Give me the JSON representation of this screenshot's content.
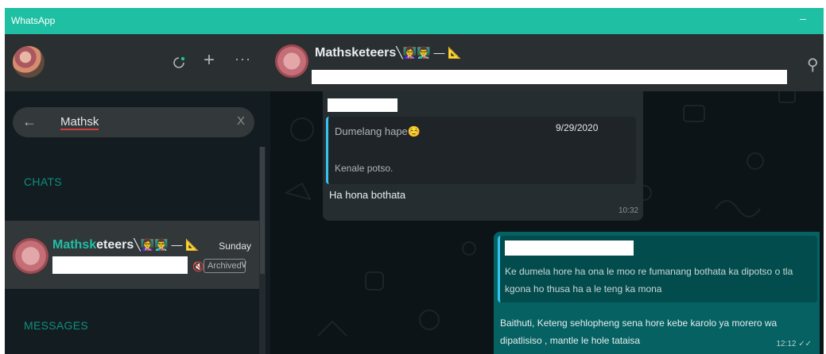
{
  "window": {
    "title": "WhatsApp",
    "minimize_symbol": "‒"
  },
  "sidebar": {
    "avatar_icon": "profile-avatar",
    "status_icon": "status-icon",
    "new_chat_symbol": "+",
    "menu_symbol": "···",
    "search": {
      "back_symbol": "←",
      "query": "Mathsk",
      "clear_symbol": "X"
    },
    "sections": {
      "chats": "CHATS",
      "messages": "MESSAGES"
    },
    "chat": {
      "name_match": "Mathsk",
      "name_rest": "eteers",
      "name_emojis": "╲👩‍🏫👨‍🏫 — 📐",
      "day": "Sunday",
      "archived": "Archived",
      "mute_symbol": "🔇",
      "chevron": "∨"
    }
  },
  "conversation": {
    "title": "Mathsketeers",
    "title_emojis": "╲👩‍🏫👨‍🏫 — 📐",
    "search_symbol": "⚲",
    "incoming": {
      "quote_line1": "Dumelang hape☺️",
      "quote_line2": "Kenale potso.",
      "quote_date": "9/29/2020",
      "text": "Ha hona bothata",
      "time": "10:32"
    },
    "outgoing": {
      "quote": "Ke dumela hore ha ona le moo re fumanang bothata ka dipotso o tla kgona ho thusa ha a le teng ka mona",
      "text": "Baithuti, Keteng sehlopheng sena hore kebe karolo ya morero wa dipatlisiso , mantle le hole tataisa",
      "time": "12:12 ✓✓"
    }
  },
  "colors": {
    "titlebar": "#1fbfa4",
    "accent": "#1fbfa4",
    "section_label": "#0f8f7e",
    "outgoing_bubble": "#056162",
    "incoming_bubble": "#262d31",
    "quote_bar": "#35c4f0"
  }
}
